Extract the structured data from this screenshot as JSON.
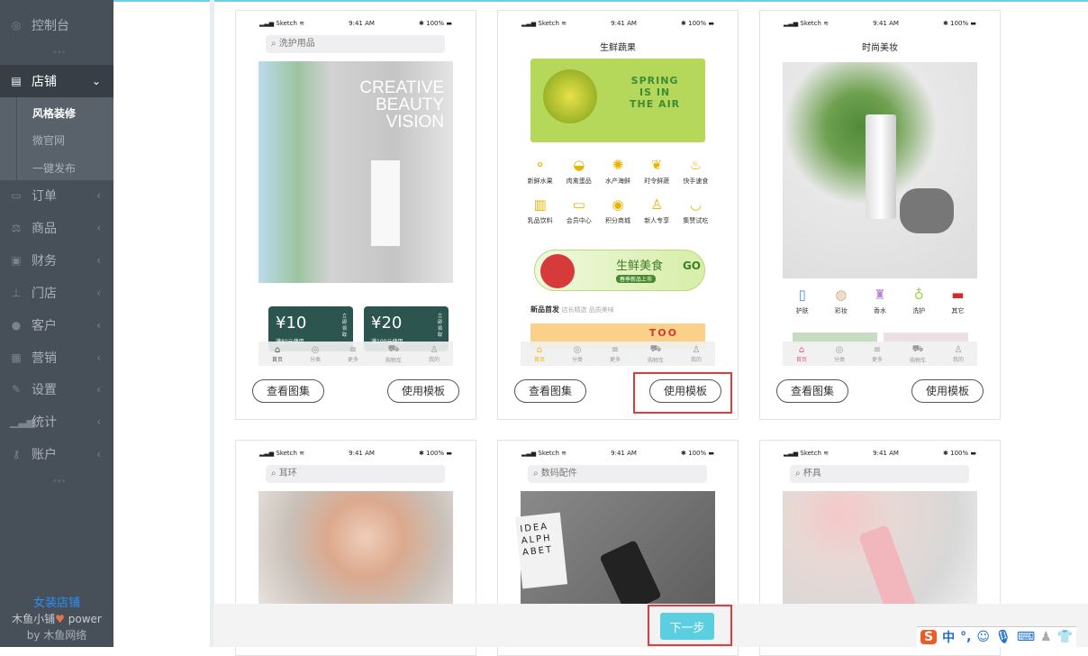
{
  "sidebar": {
    "dashboard": {
      "label": "控制台",
      "icon": "compass-icon"
    },
    "items": [
      {
        "label": "店铺",
        "icon": "basket-icon",
        "expanded": true
      },
      {
        "label": "订单",
        "icon": "money-icon"
      },
      {
        "label": "商品",
        "icon": "scale-icon"
      },
      {
        "label": "财务",
        "icon": "cash-icon"
      },
      {
        "label": "门店",
        "icon": "sitemap-icon"
      },
      {
        "label": "客户",
        "icon": "users-icon"
      },
      {
        "label": "营销",
        "icon": "gift-icon"
      },
      {
        "label": "设置",
        "icon": "wrench-icon"
      },
      {
        "label": "统计",
        "icon": "signal-icon"
      },
      {
        "label": "账户",
        "icon": "key-icon"
      }
    ],
    "submenu": [
      "风格装修",
      "微官网",
      "一键发布"
    ],
    "footer": {
      "shop": "女装店铺",
      "powered": "木鱼小铺",
      "power": "power",
      "by": "by 木鱼网络"
    },
    "accent": "#2a8ff7"
  },
  "templates": [
    {
      "status": {
        "carrier": "Sketch",
        "time": "9:41 AM",
        "battery": "100%"
      },
      "search": "洗护用品",
      "hero": [
        "CREATIVE",
        "BEAUTY",
        "VISION"
      ],
      "coupons": [
        {
          "amount": "10",
          "cond": "满80元使用",
          "action": "立即领取"
        },
        {
          "amount": "20",
          "cond": "满100元使用",
          "action": "立即领取"
        }
      ],
      "view": "查看图集",
      "use": "使用模板"
    },
    {
      "status": {
        "carrier": "Sketch",
        "time": "9:41 AM",
        "battery": "100%"
      },
      "title": "生鲜蔬果",
      "hero": [
        "SPRING",
        "IS IN",
        "THE AIR"
      ],
      "cats": [
        "新鲜水果",
        "肉禽蛋品",
        "水产海鲜",
        "时令鲜蔬",
        "快手速食",
        "乳品饮料",
        "会员中心",
        "积分商城",
        "新人专享",
        "集赞试吃"
      ],
      "banner": "生鲜美食",
      "banner_sub": "春季新品上市",
      "banner_go": "GO",
      "section": "新品首发",
      "section_sub": "店长精选 品质美味",
      "promo": "TOO",
      "view": "查看图集",
      "use": "使用模板"
    },
    {
      "status": {
        "carrier": "Sketch",
        "time": "9:41 AM",
        "battery": "100%"
      },
      "title": "时尚美妆",
      "cats": [
        "护肤",
        "彩妆",
        "香水",
        "洗护",
        "其它"
      ],
      "view": "查看图集",
      "use": "使用模板"
    },
    {
      "status": {
        "carrier": "Sketch",
        "time": "9:41 AM",
        "battery": "100%"
      },
      "search": "耳环"
    },
    {
      "status": {
        "carrier": "Sketch",
        "time": "9:41 AM",
        "battery": "100%"
      },
      "search": "数码配件",
      "hero": [
        "IDEA",
        "ALPH",
        "ABET"
      ]
    },
    {
      "status": {
        "carrier": "Sketch",
        "time": "9:41 AM",
        "battery": "100%"
      },
      "search": "杯具"
    }
  ],
  "tabbar": [
    "首页",
    "分类",
    "更多",
    "购物车",
    "我的"
  ],
  "next_label": "下一步",
  "ime": {
    "logo": "S",
    "mode": "中",
    "punct": "°,"
  },
  "colors": {
    "primary": "#5bcfe0",
    "highlight": "#e23b3b",
    "sidebar": "#474f59"
  }
}
